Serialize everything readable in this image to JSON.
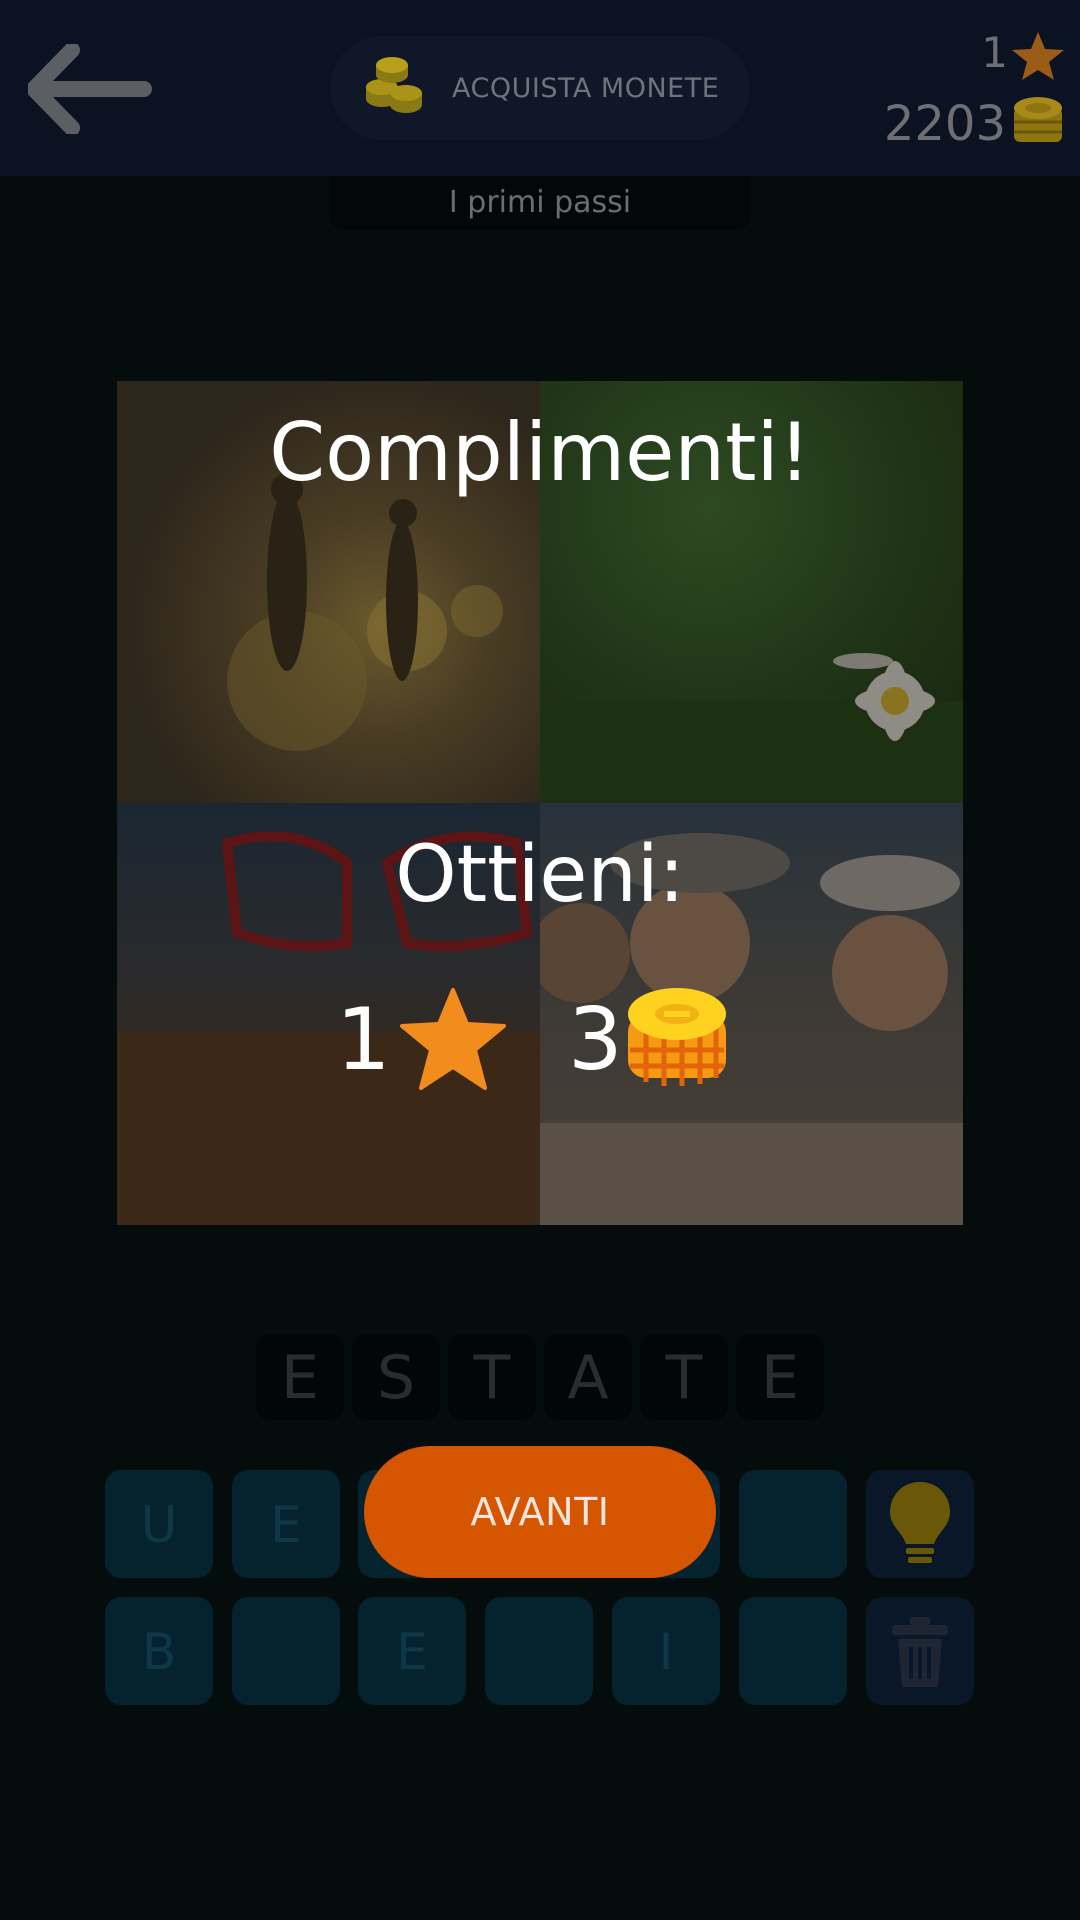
{
  "header": {
    "buy_coins_label": "ACQUISTA MONETE",
    "stars": "1",
    "coins": "2203",
    "level_name": "I primi passi"
  },
  "popup": {
    "title": "Complimenti!",
    "subtitle": "Ottieni:",
    "reward_stars": "1",
    "reward_coins": "3",
    "continue_label": "AVANTI"
  },
  "answer": [
    "E",
    "S",
    "T",
    "A",
    "T",
    "E"
  ],
  "keyboard": {
    "row1": [
      "U",
      "E",
      "",
      "",
      "",
      ""
    ],
    "row2": [
      "B",
      "",
      "E",
      "",
      "I",
      ""
    ]
  },
  "colors": {
    "accent": "#d55500",
    "star": "#f28c1c",
    "coin": "#f7c21a"
  },
  "icons": {
    "back": "arrow-left-icon",
    "buy": "coins-stack-icon",
    "hint": "lightbulb-icon",
    "delete": "trash-icon"
  }
}
